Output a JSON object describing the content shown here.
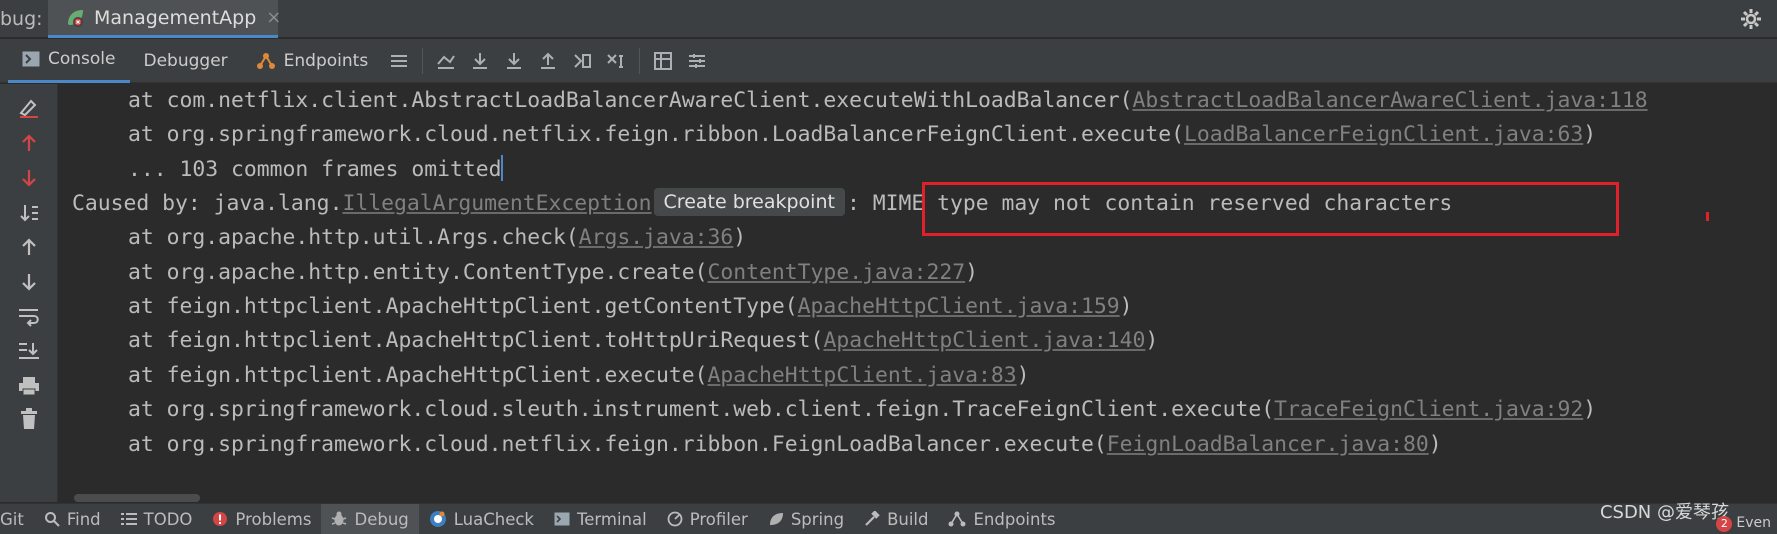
{
  "topbar": {
    "debug_label": "bug:",
    "run_tab_label": "ManagementApp",
    "close_glyph": "×"
  },
  "toolbar": {
    "tabs": [
      {
        "label": "Console",
        "icon": "console-icon",
        "active": true
      },
      {
        "label": "Debugger",
        "icon": "",
        "active": false
      },
      {
        "label": "Endpoints",
        "icon": "endpoints-icon",
        "active": false
      }
    ],
    "icons": [
      "list-icon",
      "show-execution-point-icon",
      "step-over-icon",
      "step-into-icon",
      "step-out-icon",
      "run-to-cursor-icon",
      "evaluate-icon",
      "table-icon",
      "settings-list-icon"
    ]
  },
  "gutter_icons": [
    "clear-icon",
    "up-red-icon",
    "down-red-icon",
    "sort-icon",
    "up-icon",
    "down-icon",
    "soft-wrap-icon",
    "scroll-to-end-icon",
    "print-icon",
    "trash-icon"
  ],
  "console": {
    "lines": [
      {
        "prefix": "at com.netflix.client.AbstractLoadBalancerAwareClient.executeWithLoadBalancer(",
        "link": "AbstractLoadBalancerAwareClient.java:118",
        "suffix": ""
      },
      {
        "prefix": "at org.springframework.cloud.netflix.feign.ribbon.LoadBalancerFeignClient.execute(",
        "link": "LoadBalancerFeignClient.java:63",
        "suffix": ")"
      },
      {
        "prefix": "... 103 common frames omitted",
        "link": "",
        "suffix": ""
      },
      {
        "caused_prefix": "Caused by: java.lang.",
        "exception": "IllegalArgumentException",
        "chip": "Create breakpoint",
        "message": ": MIME type may not contain reserved characters"
      },
      {
        "prefix": "at org.apache.http.util.Args.check(",
        "link": "Args.java:36",
        "suffix": ")"
      },
      {
        "prefix": "at org.apache.http.entity.ContentType.create(",
        "link": "ContentType.java:227",
        "suffix": ")"
      },
      {
        "prefix": "at feign.httpclient.ApacheHttpClient.getContentType(",
        "link": "ApacheHttpClient.java:159",
        "suffix": ")"
      },
      {
        "prefix": "at feign.httpclient.ApacheHttpClient.toHttpUriRequest(",
        "link": "ApacheHttpClient.java:140",
        "suffix": ")"
      },
      {
        "prefix": "at feign.httpclient.ApacheHttpClient.execute(",
        "link": "ApacheHttpClient.java:83",
        "suffix": ")"
      },
      {
        "prefix": "at org.springframework.cloud.sleuth.instrument.web.client.feign.TraceFeignClient.execute(",
        "link": "TraceFeignClient.java:92",
        "suffix": ")"
      },
      {
        "prefix": "at org.springframework.cloud.netflix.feign.ribbon.FeignLoadBalancer.execute(",
        "link": "FeignLoadBalancer.java:80",
        "suffix": ")"
      }
    ]
  },
  "bottombar": {
    "items": [
      {
        "label": "Git",
        "icon": "",
        "active": false
      },
      {
        "label": "Find",
        "icon": "search-icon",
        "active": false
      },
      {
        "label": "TODO",
        "icon": "todo-icon",
        "active": false
      },
      {
        "label": "Problems",
        "icon": "problems-icon",
        "active": false
      },
      {
        "label": "Debug",
        "icon": "bug-icon",
        "active": true
      },
      {
        "label": "LuaCheck",
        "icon": "luacheck-icon",
        "active": false
      },
      {
        "label": "Terminal",
        "icon": "terminal-icon",
        "active": false
      },
      {
        "label": "Profiler",
        "icon": "profiler-icon",
        "active": false
      },
      {
        "label": "Spring",
        "icon": "spring-icon",
        "active": false
      },
      {
        "label": "Build",
        "icon": "hammer-icon",
        "active": false
      },
      {
        "label": "Endpoints",
        "icon": "endpoints-icon",
        "active": false
      }
    ],
    "watermark": "CSDN @爱琴孩",
    "event_count": "2",
    "event_label": "Even"
  },
  "colors": {
    "accent": "#4a88c7",
    "highlight": "#e0202a",
    "error_icon": "#d64545"
  }
}
